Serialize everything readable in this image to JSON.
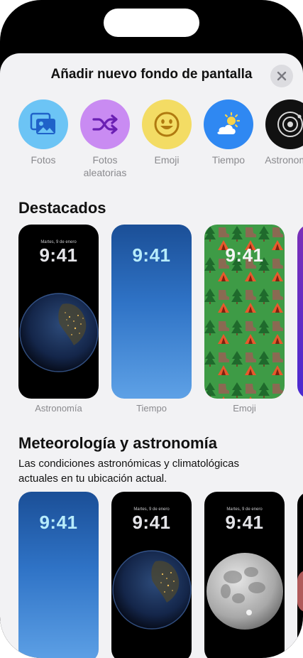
{
  "sheet": {
    "title": "Añadir nuevo fondo de pantalla"
  },
  "categories": [
    {
      "lines": [
        "Fotos"
      ],
      "icon": "photos-icon",
      "color": "#6cc4f5"
    },
    {
      "lines": [
        "Fotos",
        "aleatorias"
      ],
      "icon": "shuffle-icon",
      "color": "#c98bf2"
    },
    {
      "lines": [
        "Emoji"
      ],
      "icon": "emoji-smile-icon",
      "color": "#f3dc64"
    },
    {
      "lines": [
        "Tiempo"
      ],
      "icon": "weather-icon",
      "color": "#2f88f2"
    },
    {
      "lines": [
        "Astronomía"
      ],
      "icon": "astronomy-icon",
      "color": "#111111"
    }
  ],
  "featured": {
    "title": "Destacados",
    "cards": [
      {
        "label": "Astronomía",
        "date": "Martes, 9 de enero",
        "time": "9:41"
      },
      {
        "label": "Tiempo",
        "date": "",
        "time": "9:41"
      },
      {
        "label": "Emoji",
        "date": "",
        "time": "9:41"
      }
    ]
  },
  "weather": {
    "title": "Meteorología y astronomía",
    "description": "Las condiciones astronómicas y climatológicas actuales en tu ubicación actual.",
    "cards": [
      {
        "date": "",
        "time": "9:41"
      },
      {
        "date": "Martes, 9 de enero",
        "time": "9:41"
      },
      {
        "date": "Martes, 9 de enero",
        "time": "9:41"
      }
    ]
  }
}
